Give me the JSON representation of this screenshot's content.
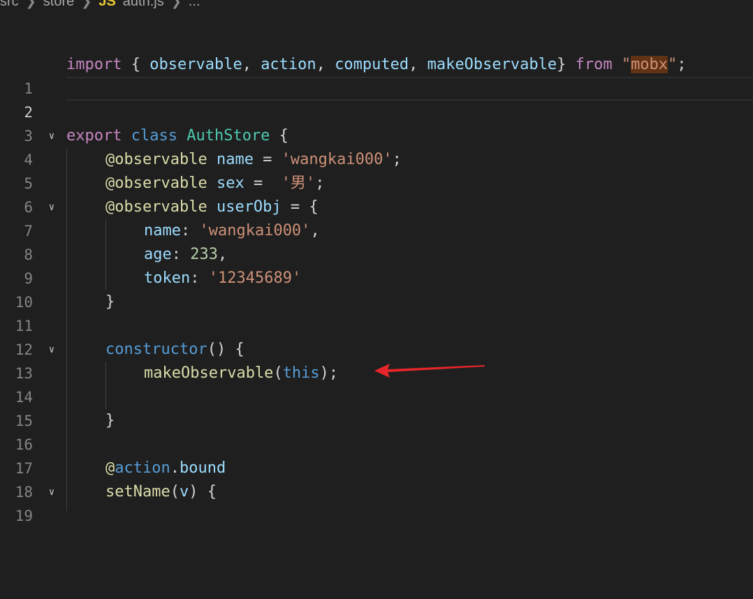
{
  "breadcrumb": {
    "folder1": "src",
    "folder2": "store",
    "file_badge": "JS",
    "file": "auth.js",
    "more": "..."
  },
  "gutter": {
    "active_line": 2,
    "line_numbers": [
      "1",
      "2",
      "3",
      "4",
      "5",
      "6",
      "7",
      "8",
      "9",
      "10",
      "11",
      "12",
      "13",
      "14",
      "15",
      "16",
      "17",
      "18",
      "19"
    ],
    "fold_icon_lines": [
      4,
      7,
      13,
      19
    ]
  },
  "code": {
    "l1": {
      "kw_import": "import",
      "open": " { ",
      "id1": "observable",
      "c1": ", ",
      "id2": "action",
      "c2": ", ",
      "id3": "computed",
      "c3": ", ",
      "id4": "makeObservable",
      "close": "} ",
      "kw_from": "from",
      "sp": " ",
      "q1": "\"",
      "mod": "mobx",
      "q2": "\"",
      "semi": ";"
    },
    "l4": {
      "kw_export": "export",
      "kw_class": "class",
      "cls": "AuthStore",
      "brace": " {"
    },
    "l5": {
      "dec": "@observable",
      "prop": "name",
      "eq": " = ",
      "str": "'wangkai000'",
      "semi": ";"
    },
    "l6": {
      "dec": "@observable",
      "prop": "sex",
      "eq": " =  ",
      "str": "'男'",
      "semi": ";"
    },
    "l7": {
      "dec": "@observable",
      "prop": "userObj",
      "eq": " = {"
    },
    "l8": {
      "key": "name",
      "colon": ": ",
      "str": "'wangkai000'",
      "comma": ","
    },
    "l9": {
      "key": "age",
      "colon": ": ",
      "num": "233",
      "comma": ","
    },
    "l10": {
      "key": "token",
      "colon": ": ",
      "str": "'12345689'"
    },
    "l11": {
      "brace": "}"
    },
    "l13": {
      "kw": "constructor",
      "rest": "() {"
    },
    "l14": {
      "fn": "makeObservable",
      "open": "(",
      "this": "this",
      "close": ");"
    },
    "l16": {
      "brace": "}"
    },
    "l18": {
      "at": "@",
      "obj": "action",
      "dot": ".",
      "prop": "bound"
    },
    "l19": {
      "fn": "setName",
      "open": "(",
      "param": "v",
      "rest": ") {"
    }
  },
  "annotation": {
    "arrow_color": "#e8262a"
  }
}
